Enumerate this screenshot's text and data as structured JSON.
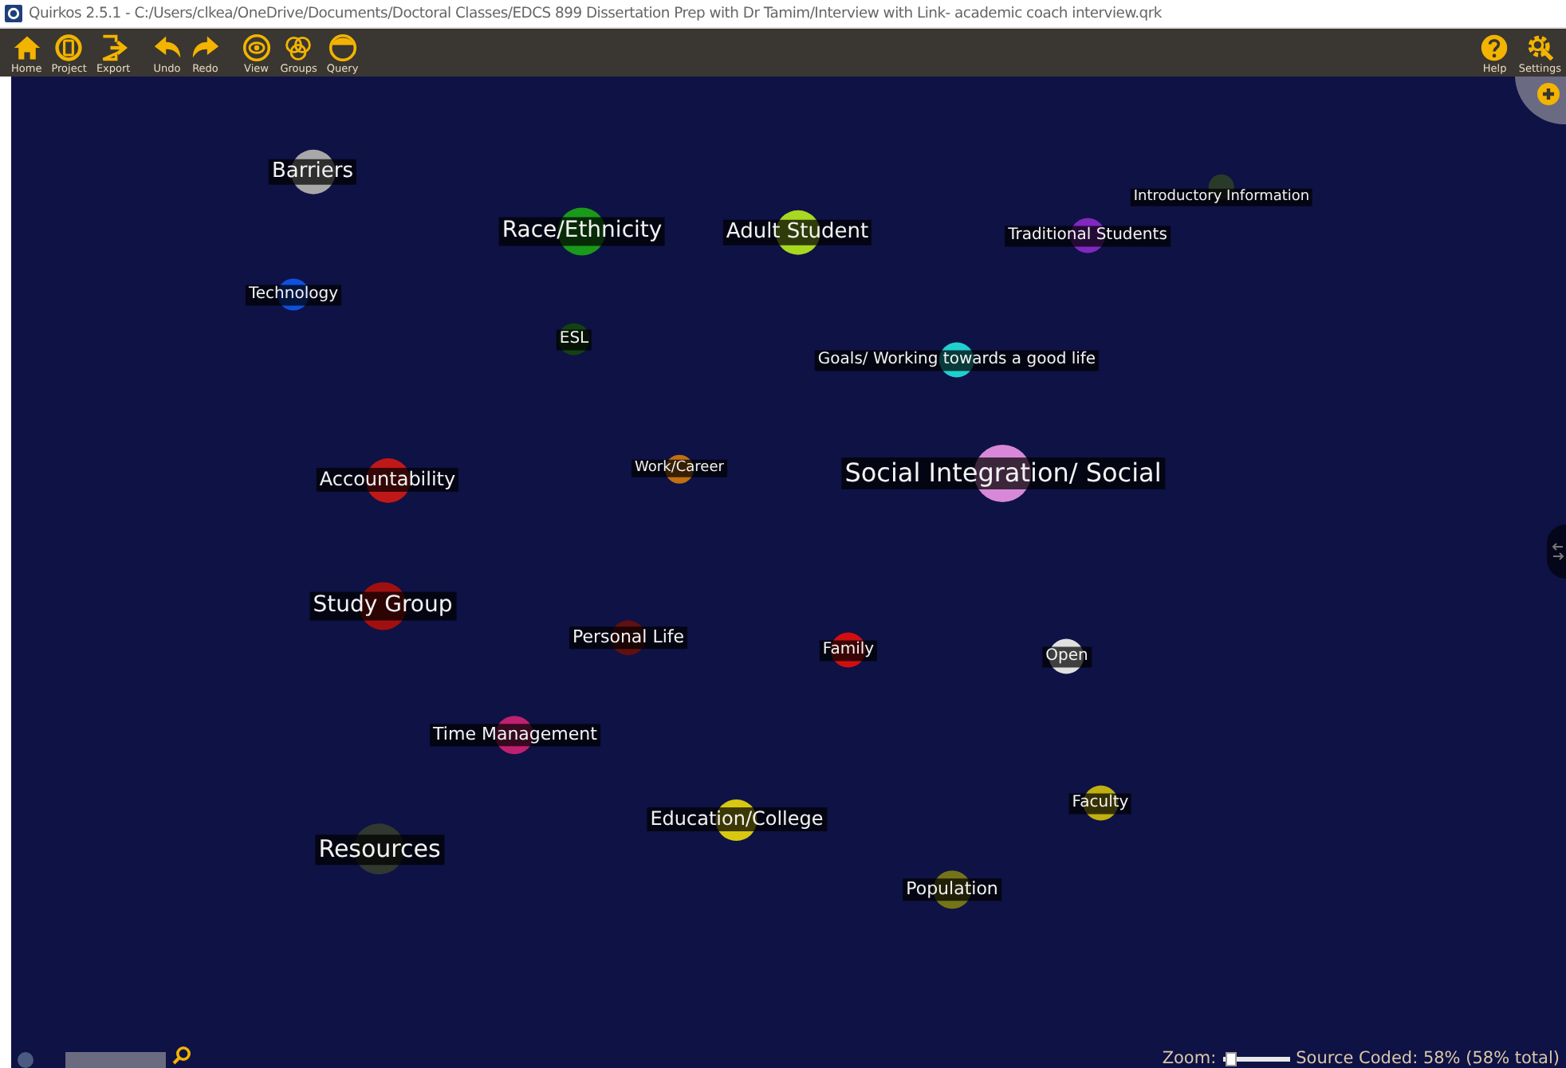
{
  "window": {
    "title": "Quirkos 2.5.1 - C:/Users/clkea/OneDrive/Documents/Doctoral Classes/EDCS 899 Dissertation Prep with Dr Tamim/Interview with Link- academic coach interview.qrk"
  },
  "toolbar": {
    "left": [
      {
        "label": "Home"
      },
      {
        "label": "Project"
      },
      {
        "label": "Export"
      },
      {
        "label": "Undo"
      },
      {
        "label": "Redo"
      },
      {
        "label": "View"
      },
      {
        "label": "Groups"
      },
      {
        "label": "Query"
      }
    ],
    "right": [
      {
        "label": "Help"
      },
      {
        "label": "Settings"
      }
    ]
  },
  "canvas": {
    "nodes": [
      {
        "label": "Barriers",
        "color": "#a8a8a8"
      },
      {
        "label": "Race/Ethnicity",
        "color": "#1a9a1a"
      },
      {
        "label": "Adult Student",
        "color": "#a8d820"
      },
      {
        "label": "Introductory Information",
        "color": "#2a3a2a"
      },
      {
        "label": "Traditional Students",
        "color": "#8028c0"
      },
      {
        "label": "Technology",
        "color": "#1050e0"
      },
      {
        "label": "ESL",
        "color": "#124212"
      },
      {
        "label": "Goals/ Working towards a good life",
        "color": "#20d0d0"
      },
      {
        "label": "Accountability",
        "color": "#c01818"
      },
      {
        "label": "Work/Career",
        "color": "#c07010"
      },
      {
        "label": "Social Integration/ Social",
        "color": "#d888d8"
      },
      {
        "label": "Study Group",
        "color": "#a01010"
      },
      {
        "label": "Personal Life",
        "color": "#601010"
      },
      {
        "label": "Family",
        "color": "#d01010"
      },
      {
        "label": "Open",
        "color": "#e0e0e0"
      },
      {
        "label": "Time Management",
        "color": "#c02070"
      },
      {
        "label": "Faculty",
        "color": "#c0b010"
      },
      {
        "label": "Education/College",
        "color": "#d8c810"
      },
      {
        "label": "Population",
        "color": "#747418"
      },
      {
        "label": "Resources",
        "color": "#303830"
      }
    ]
  },
  "status": {
    "zoom_label": "Zoom:",
    "zoom": {
      "level": 0.05
    },
    "source_coded": "Source Coded: 58% (58% total)"
  }
}
